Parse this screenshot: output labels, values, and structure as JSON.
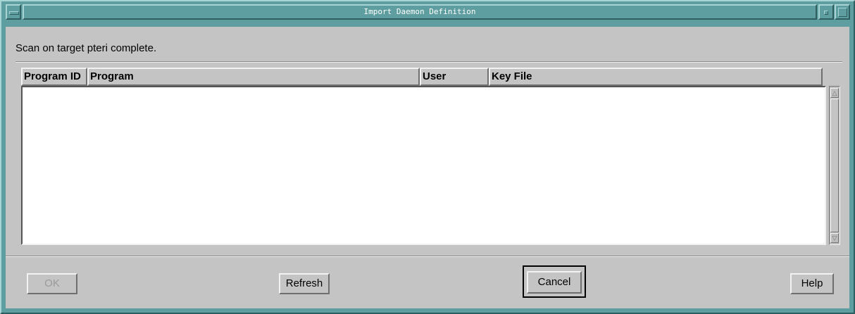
{
  "window": {
    "title": "Import Daemon Definition"
  },
  "status": {
    "message": "Scan on target pteri complete."
  },
  "table": {
    "columns": [
      "Program ID",
      "Program",
      "User",
      "Key File"
    ],
    "rows": []
  },
  "scrollbar": {
    "up_arrow": "△",
    "down_arrow": "▽"
  },
  "buttons": {
    "ok": "OK",
    "refresh": "Refresh",
    "cancel": "Cancel",
    "help": "Help"
  },
  "colors": {
    "frame": "#5f9ea0",
    "dialog_bg": "#c4c4c4",
    "list_bg": "#ffffff"
  }
}
